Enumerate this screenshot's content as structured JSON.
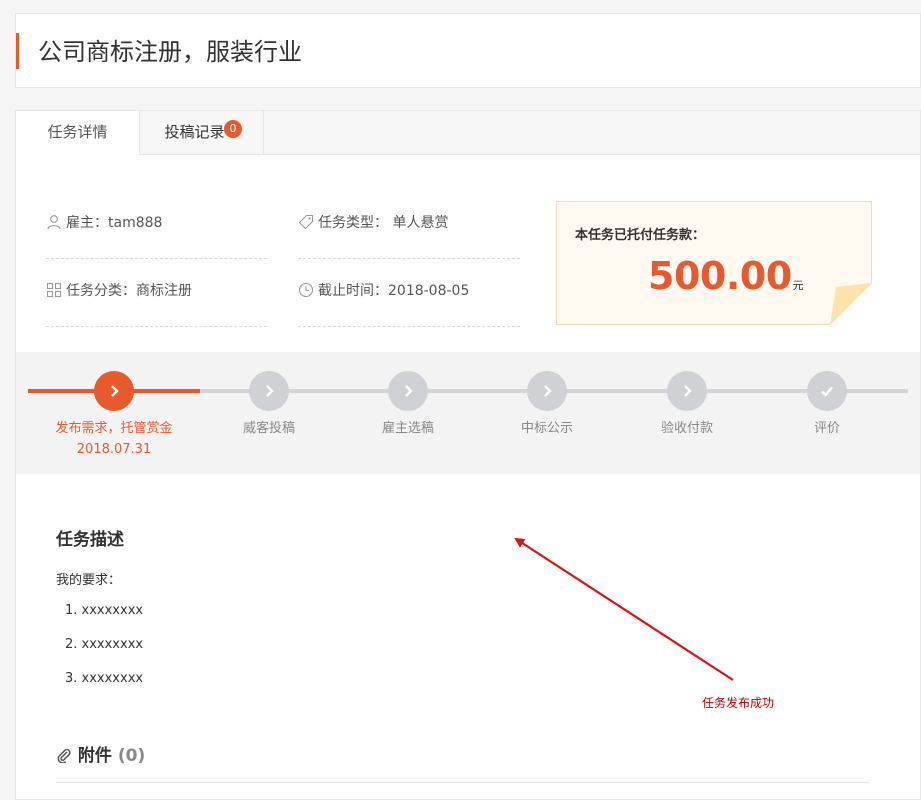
{
  "page": {
    "title": "公司商标注册，服装行业"
  },
  "tabs": [
    {
      "label": "任务详情",
      "active": true
    },
    {
      "label": "投稿记录",
      "badge": "0"
    }
  ],
  "info": {
    "employer": "雇主：tam888",
    "task_type": "任务类型： 单人悬赏",
    "category": "任务分类：商标注册",
    "deadline": "截止时间：2018-08-05"
  },
  "payment": {
    "label": "本任务已托付任务款：",
    "amount": "500.00",
    "unit": "元"
  },
  "progress": {
    "steps": [
      {
        "label": "发布需求，托管赏金",
        "date": "2018.07.31",
        "state": "done"
      },
      {
        "label": "威客投稿",
        "state": "pending"
      },
      {
        "label": "雇主选稿",
        "state": "pending"
      },
      {
        "label": "中标公示",
        "state": "pending"
      },
      {
        "label": "验收付款",
        "state": "pending"
      },
      {
        "label": "评价",
        "state": "pending"
      }
    ]
  },
  "description": {
    "title": "任务描述",
    "intro": "我的要求：",
    "items": [
      "1. xxxxxxxx",
      "2. xxxxxxxx",
      "3. xxxxxxxx"
    ]
  },
  "attachments": {
    "title": "附件",
    "count": "(0)"
  },
  "annotation": {
    "text": "任务发布成功"
  },
  "colors": {
    "accent": "#e9592e",
    "step_pending": "#cfd1d4",
    "annotation": "#cc0000"
  }
}
